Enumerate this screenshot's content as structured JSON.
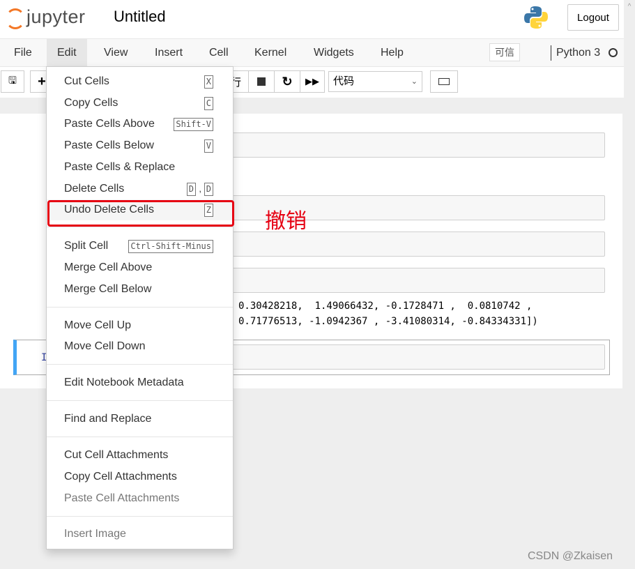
{
  "header": {
    "logo_text": "jupyter",
    "notebook_title": "Untitled",
    "logout_label": "Logout"
  },
  "menubar": {
    "items": [
      "File",
      "Edit",
      "View",
      "Insert",
      "Cell",
      "Kernel",
      "Widgets",
      "Help"
    ],
    "open": "Edit",
    "trusted_label": "可信",
    "kernel_name": "Python 3"
  },
  "toolbar": {
    "run_partial": "行",
    "cell_type": "代码"
  },
  "output": {
    "lines": [
      "0.30428218,  1.49066432, -0.1728471 ,  0.0810742 ,",
      "0.71776513, -1.0942367 , -3.41080314, -0.84334331])"
    ]
  },
  "prompt": "I",
  "edit_menu": {
    "cut_cells": {
      "label": "Cut Cells",
      "shortcut": "X"
    },
    "copy_cells": {
      "label": "Copy Cells",
      "shortcut": "C"
    },
    "paste_above": {
      "label": "Paste Cells Above",
      "shortcut": "Shift-V"
    },
    "paste_below": {
      "label": "Paste Cells Below",
      "shortcut": "V"
    },
    "paste_replace": {
      "label": "Paste Cells & Replace"
    },
    "delete_cells": {
      "label": "Delete Cells",
      "shortcut1": "D",
      "shortcut2": "D",
      "sep": ","
    },
    "undo_delete": {
      "label": "Undo Delete Cells",
      "shortcut": "Z"
    },
    "split_cell": {
      "label": "Split Cell",
      "shortcut": "Ctrl-Shift-Minus"
    },
    "merge_above": {
      "label": "Merge Cell Above"
    },
    "merge_below": {
      "label": "Merge Cell Below"
    },
    "move_up": {
      "label": "Move Cell Up"
    },
    "move_down": {
      "label": "Move Cell Down"
    },
    "edit_metadata": {
      "label": "Edit Notebook Metadata"
    },
    "find_replace": {
      "label": "Find and Replace"
    },
    "cut_attach": {
      "label": "Cut Cell Attachments"
    },
    "copy_attach": {
      "label": "Copy Cell Attachments"
    },
    "paste_attach": {
      "label": "Paste Cell Attachments",
      "disabled": true
    },
    "insert_image": {
      "label": "Insert Image",
      "disabled": true
    }
  },
  "annotation": {
    "text": "撤销",
    "color": "#e60012"
  },
  "watermark": "CSDN @Zkaisen",
  "colors": {
    "accent": "#f37726",
    "selected_cell": "#42a5f5"
  }
}
